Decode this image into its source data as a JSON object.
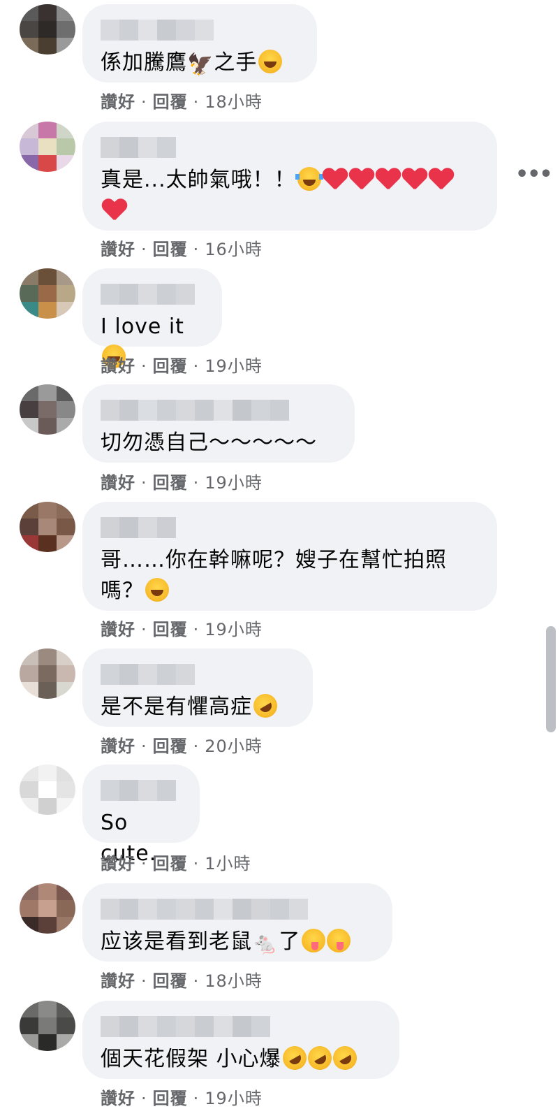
{
  "comments": [
    {
      "text": "係加騰鷹",
      "suffix": "之手",
      "emoji": [
        "laugh"
      ],
      "like": "讚好",
      "reply": "回覆",
      "time": "18小時"
    },
    {
      "text": "真是...太帥氣哦！！",
      "suffix": "",
      "emoji": [
        "cry",
        "heart",
        "heart",
        "heart",
        "heart",
        "heart",
        "heart"
      ],
      "like": "讚好",
      "reply": "回覆",
      "time": "16小時"
    },
    {
      "text": "I love it",
      "suffix": "",
      "emoji": [
        "laugh"
      ],
      "like": "讚好",
      "reply": "回覆",
      "time": "19小時"
    },
    {
      "text": "切勿憑自己～～～～～",
      "suffix": "",
      "emoji": [],
      "like": "讚好",
      "reply": "回覆",
      "time": "19小時"
    },
    {
      "text": "哥……你在幹嘛呢？嫂子在幫忙拍照\n嗎？",
      "suffix": "",
      "emoji": [
        "laugh"
      ],
      "like": "讚好",
      "reply": "回覆",
      "time": "19小時"
    },
    {
      "text": "是不是有懼高症",
      "suffix": "",
      "emoji": [
        "rofl"
      ],
      "like": "讚好",
      "reply": "回覆",
      "time": "20小時"
    },
    {
      "text": "So cute.",
      "suffix": "",
      "emoji": [],
      "like": "讚好",
      "reply": "回覆",
      "time": "1小時"
    },
    {
      "text": "应该是看到老鼠",
      "suffix": "了",
      "emoji": [
        "wink",
        "wink"
      ],
      "like": "讚好",
      "reply": "回覆",
      "time": "18小時"
    },
    {
      "text": "個天花假架 小心爆",
      "suffix": "",
      "emoji": [
        "rofl",
        "rofl",
        "rofl"
      ],
      "like": "讚好",
      "reply": "回覆",
      "time": "19小時"
    }
  ],
  "icons": {
    "more": "more-options-icon",
    "eagle": "🦅",
    "mouse": "🐁"
  },
  "more_label": "•••",
  "colors": {
    "bubble": "#f0f2f5",
    "meta": "#65676b",
    "text": "#050505"
  }
}
